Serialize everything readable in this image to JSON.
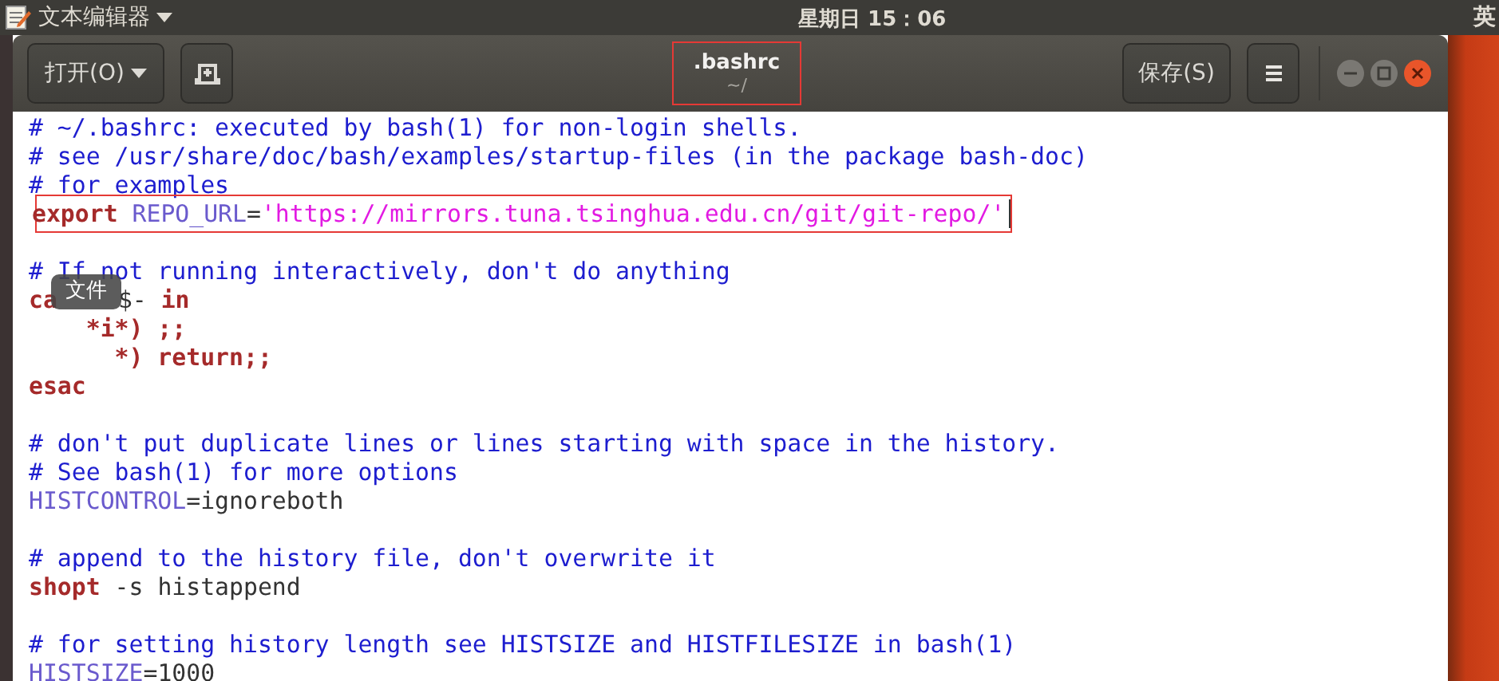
{
  "top_bar": {
    "app_menu": "文本编辑器",
    "clock": "星期日 15：06",
    "input_method": "英"
  },
  "window": {
    "open_button": "打开(O)",
    "title": ".bashrc",
    "subtitle": "~/",
    "title_highlighted": true,
    "save_button": "保存(S)"
  },
  "tooltip": {
    "text": "文件"
  },
  "editor": {
    "lines": [
      {
        "kind": "code",
        "highlighted": false,
        "cursor": false,
        "segments": [
          {
            "kind": "comment",
            "text": "# ~/.bashrc: executed by bash(1) for non-login shells."
          }
        ]
      },
      {
        "kind": "code",
        "highlighted": false,
        "cursor": false,
        "segments": [
          {
            "kind": "comment",
            "text": "# see /usr/share/doc/bash/examples/startup-files (in the package bash-doc)"
          }
        ]
      },
      {
        "kind": "code",
        "highlighted": false,
        "cursor": false,
        "segments": [
          {
            "kind": "comment",
            "text": "# for examples"
          }
        ]
      },
      {
        "kind": "code",
        "highlighted": true,
        "cursor": true,
        "segments": [
          {
            "kind": "keyword",
            "text": "export"
          },
          {
            "kind": "variable",
            "text": " REPO_URL"
          },
          {
            "kind": "plain",
            "text": "="
          },
          {
            "kind": "string",
            "text": "'https://mirrors.tuna.tsinghua.edu.cn/git/git-repo/'"
          }
        ]
      },
      {
        "kind": "blank"
      },
      {
        "kind": "code",
        "highlighted": false,
        "cursor": false,
        "segments": [
          {
            "kind": "comment",
            "text": "# If not running interactively, don't do anything"
          }
        ]
      },
      {
        "kind": "tooltip_line",
        "highlighted": false,
        "cursor": false,
        "segments": [
          {
            "kind": "keyword",
            "text": "ca"
          },
          {
            "kind": "tooltip"
          },
          {
            "kind": "plain",
            "text": "$- "
          },
          {
            "kind": "keyword",
            "text": "in"
          }
        ]
      },
      {
        "kind": "code",
        "highlighted": false,
        "cursor": false,
        "segments": [
          {
            "kind": "keyword",
            "text": "    *i*) ;;"
          }
        ]
      },
      {
        "kind": "code",
        "highlighted": false,
        "cursor": false,
        "segments": [
          {
            "kind": "keyword",
            "text": "      *) return;;"
          }
        ]
      },
      {
        "kind": "code",
        "highlighted": false,
        "cursor": false,
        "segments": [
          {
            "kind": "keyword",
            "text": "esac"
          }
        ]
      },
      {
        "kind": "blank"
      },
      {
        "kind": "code",
        "highlighted": false,
        "cursor": false,
        "segments": [
          {
            "kind": "comment",
            "text": "# don't put duplicate lines or lines starting with space in the history."
          }
        ]
      },
      {
        "kind": "code",
        "highlighted": false,
        "cursor": false,
        "segments": [
          {
            "kind": "comment",
            "text": "# See bash(1) for more options"
          }
        ]
      },
      {
        "kind": "code",
        "highlighted": false,
        "cursor": false,
        "segments": [
          {
            "kind": "variable",
            "text": "HISTCONTROL"
          },
          {
            "kind": "plain",
            "text": "=ignoreboth"
          }
        ]
      },
      {
        "kind": "blank"
      },
      {
        "kind": "code",
        "highlighted": false,
        "cursor": false,
        "segments": [
          {
            "kind": "comment",
            "text": "# append to the history file, don't overwrite it"
          }
        ]
      },
      {
        "kind": "code",
        "highlighted": false,
        "cursor": false,
        "segments": [
          {
            "kind": "keyword",
            "text": "shopt"
          },
          {
            "kind": "plain",
            "text": " -s histappend"
          }
        ]
      },
      {
        "kind": "blank"
      },
      {
        "kind": "code",
        "highlighted": false,
        "cursor": false,
        "segments": [
          {
            "kind": "comment",
            "text": "# for setting history length see HISTSIZE and HISTFILESIZE in bash(1)"
          }
        ]
      },
      {
        "kind": "code",
        "highlighted": false,
        "cursor": false,
        "segments": [
          {
            "kind": "variable",
            "text": "HISTSIZE"
          },
          {
            "kind": "plain",
            "text": "=1000"
          }
        ]
      }
    ]
  }
}
